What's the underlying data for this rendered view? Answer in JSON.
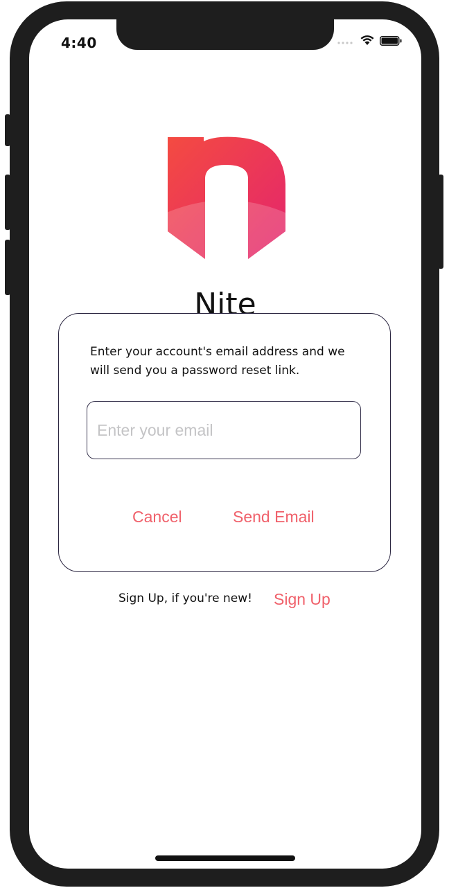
{
  "status_bar": {
    "time": "4:40",
    "icons": [
      "signal-icon",
      "wifi-icon",
      "battery-icon"
    ]
  },
  "app": {
    "name": "Nite",
    "logo_icon": "nite-logo-icon"
  },
  "dialog": {
    "message": "Enter your account's email address and we will send you a password reset link.",
    "email_placeholder": "Enter your email",
    "email_value": "",
    "cancel_label": "Cancel",
    "send_label": "Send Email"
  },
  "signup": {
    "prompt": "Sign Up, if you're new!",
    "link_label": "Sign Up"
  },
  "colors": {
    "accent": "#f0616b",
    "logo_gradient_start": "#f44b41",
    "logo_gradient_end": "#e3246e",
    "device_frame": "#1e1e1e"
  }
}
